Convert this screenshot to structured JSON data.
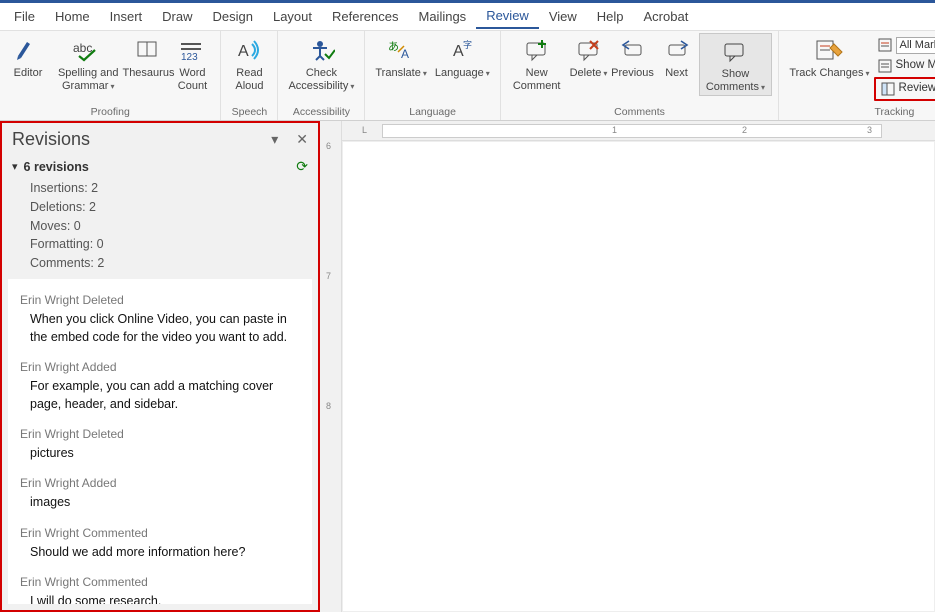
{
  "menu": {
    "tabs": [
      "File",
      "Home",
      "Insert",
      "Draw",
      "Design",
      "Layout",
      "References",
      "Mailings",
      "Review",
      "View",
      "Help",
      "Acrobat"
    ],
    "active_index": 8
  },
  "ribbon": {
    "proofing": {
      "label": "Proofing",
      "editor": "Editor",
      "spelling": "Spelling and Grammar",
      "thesaurus": "Thesaurus",
      "wordcount": "Word Count"
    },
    "speech": {
      "label": "Speech",
      "readaloud": "Read Aloud"
    },
    "accessibility": {
      "label": "Accessibility",
      "check": "Check Accessibility"
    },
    "language": {
      "label": "Language",
      "translate": "Translate",
      "language": "Language"
    },
    "comments": {
      "label": "Comments",
      "new": "New Comment",
      "delete": "Delete",
      "previous": "Previous",
      "next": "Next",
      "show": "Show Comments"
    },
    "tracking": {
      "label": "Tracking",
      "trackchanges": "Track Changes",
      "allmarkup": "All Markup",
      "showmarkup": "Show Markup",
      "reviewingpane": "Reviewing Pane"
    }
  },
  "revisions": {
    "title": "Revisions",
    "summary_title": "6 revisions",
    "stats": {
      "insertions": "Insertions: 2",
      "deletions": "Deletions: 2",
      "moves": "Moves: 0",
      "formatting": "Formatting: 0",
      "comments": "Comments: 2"
    },
    "items": [
      {
        "who": "Erin Wright Deleted",
        "what": "When you click Online Video, you can paste in the embed code for the video you want to add."
      },
      {
        "who": "Erin Wright Added",
        "what": "For example, you can add a matching cover page, header, and sidebar."
      },
      {
        "who": "Erin Wright Deleted",
        "what": "pictures"
      },
      {
        "who": "Erin Wright Added",
        "what": "images"
      },
      {
        "who": "Erin Wright Commented",
        "what": "Should we add more information here?"
      },
      {
        "who": "Erin Wright Commented",
        "what": "I will do some research."
      }
    ]
  },
  "ruler": {
    "h": [
      "L",
      "1",
      "2",
      "3"
    ],
    "v": [
      "6",
      "7",
      "8"
    ]
  }
}
